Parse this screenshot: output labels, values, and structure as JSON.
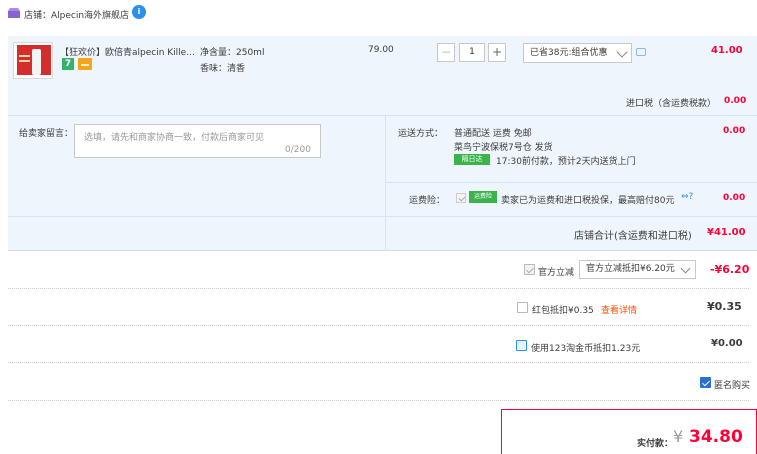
{
  "store": {
    "label": "店铺：Alpecin海外旗舰店",
    "badge": "i"
  },
  "item": {
    "title": "【狂欢价】欧倍青alpecin Kille...",
    "tag_seven": "7",
    "spec_volume": "净含量：250ml",
    "spec_scent": "香味：清香",
    "unit_price": "79.00",
    "quantity": "1",
    "minus": "−",
    "plus": "+",
    "promo_selected": "已省38元:组合优惠",
    "item_total": "41.00"
  },
  "import_tax": {
    "label": "进口税（含运费税款）",
    "value": "0.00"
  },
  "message": {
    "label": "给卖家留言：",
    "placeholder": "选填，请先和商家协商一致，付款后商家可见",
    "count": "0/200"
  },
  "shipping": {
    "label": "运送方式：",
    "line1": "普通配送 运费 免邮",
    "line2": "菜鸟宁波保税7号仓  发货",
    "badge": "隔日达",
    "line3": "17:30前付款，预计2天内送货上门",
    "value": "0.00"
  },
  "insurance": {
    "label": "运费险：",
    "logo": "运费险",
    "text": "卖家已为运费和进口税投保，最高赔付80元",
    "icons": "⇔?",
    "value": "0.00"
  },
  "store_total": {
    "label": "店铺合计(含运费和进口税)",
    "value": "¥41.00"
  },
  "discount": {
    "label": "官方立减",
    "selected": "官方立减抵扣¥6.20元",
    "value": "-¥6.20"
  },
  "red_packet": {
    "label": "红包抵扣¥0.35",
    "link": "查看详情",
    "value": "¥0.35"
  },
  "coins": {
    "label": "使用123淘金币抵扣1.23元",
    "value": "¥0.00"
  },
  "anonymous": {
    "label": "匿名购买"
  },
  "payment": {
    "label": "实付款：",
    "currency": "¥",
    "value": "34.80"
  },
  "colors": {
    "accent": "#ff0036",
    "panel": "#eef5fc",
    "link": "#ff5000",
    "blue": "#2b8ff0"
  }
}
